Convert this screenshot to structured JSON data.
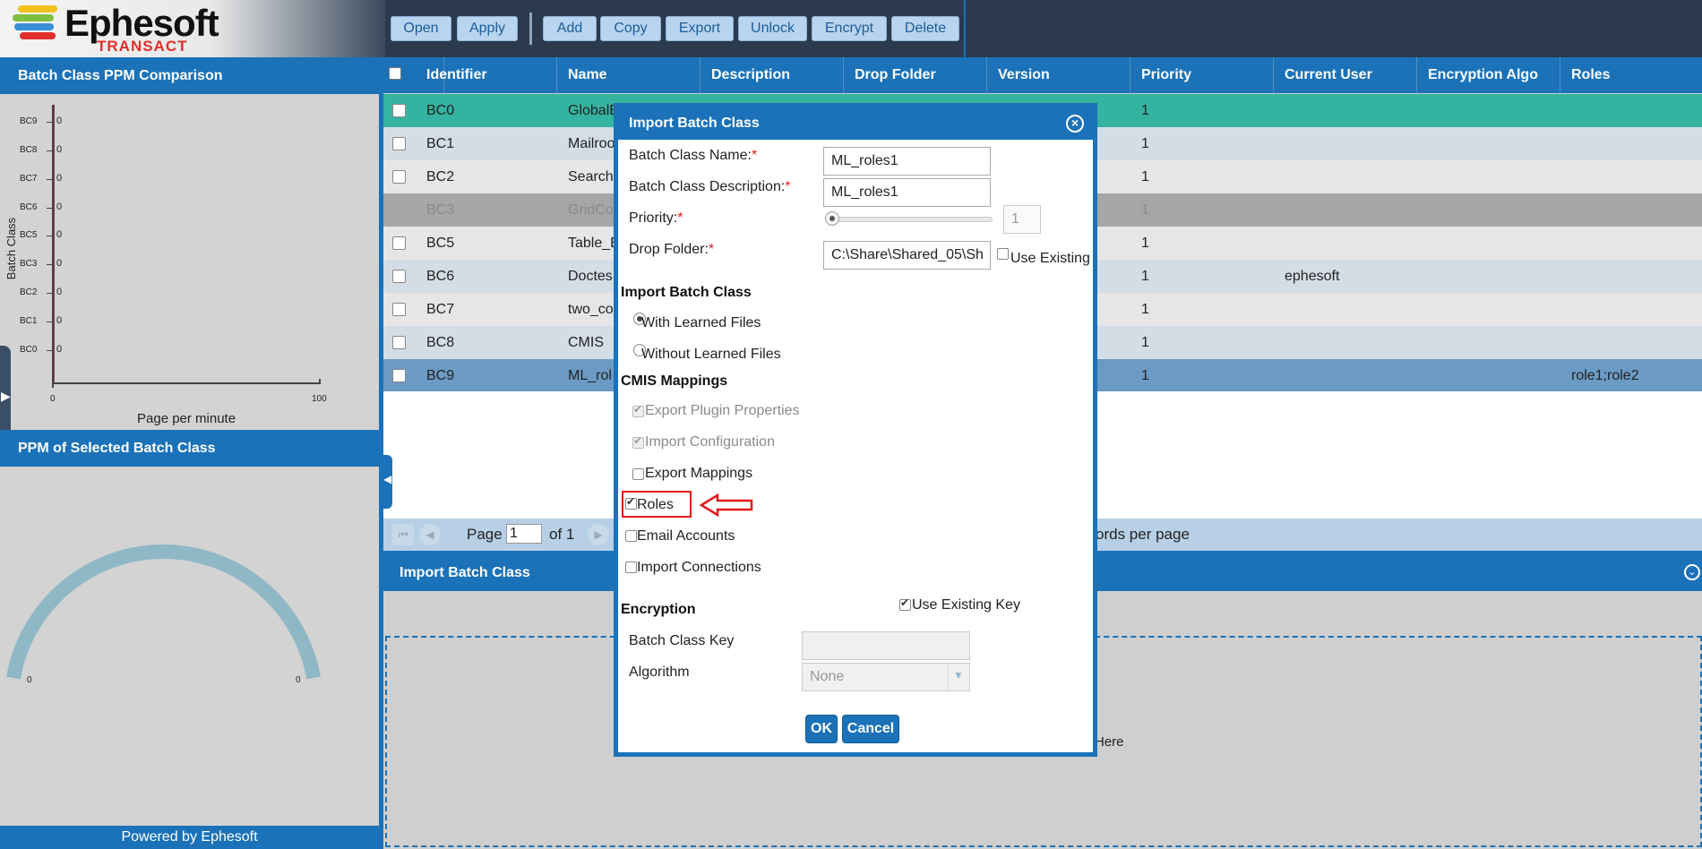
{
  "app": {
    "logo_text": "Ephesoft",
    "logo_sub": "TRANSACT",
    "footer": "Powered by Ephesoft"
  },
  "toolbar": {
    "buttons": [
      "Open",
      "Apply",
      "Add",
      "Copy",
      "Export",
      "Unlock",
      "Encrypt",
      "Delete"
    ]
  },
  "left": {
    "ppm_title": "Batch Class PPM Comparison",
    "selected_title": "PPM of Selected Batch Class",
    "gauge_min": "0",
    "gauge_max": "0"
  },
  "chart_data": {
    "type": "bar",
    "orientation": "horizontal",
    "categories": [
      "BC9",
      "BC8",
      "BC7",
      "BC6",
      "BC5",
      "BC3",
      "BC2",
      "BC1",
      "BC0"
    ],
    "values": [
      0,
      0,
      0,
      0,
      0,
      0,
      0,
      0,
      0
    ],
    "value_labels": [
      "0",
      "0",
      "0",
      "0",
      "0",
      "0",
      "0",
      "0",
      "0"
    ],
    "xlabel": "Page per minute",
    "ylabel": "Batch Class",
    "xlim": [
      0,
      100
    ],
    "x_ticks": [
      "0",
      "100"
    ]
  },
  "grid": {
    "columns": [
      "Identifier",
      "Name",
      "Description",
      "Drop Folder",
      "Version",
      "Priority",
      "Current User",
      "Encryption Algo",
      "Roles"
    ],
    "rows": [
      {
        "id": "BC0",
        "name": "GlobalE",
        "priority": "1",
        "user": "",
        "roles": ""
      },
      {
        "id": "BC1",
        "name": "Mailroo",
        "priority": "1",
        "user": "",
        "roles": ""
      },
      {
        "id": "BC2",
        "name": "Search",
        "priority": "1",
        "user": "",
        "roles": ""
      },
      {
        "id": "BC3",
        "name": "GridCo",
        "priority": "1",
        "user": "",
        "roles": ""
      },
      {
        "id": "BC5",
        "name": "Table_E",
        "priority": "1",
        "user": "",
        "roles": ""
      },
      {
        "id": "BC6",
        "name": "Doctes",
        "priority": "1",
        "user": "ephesoft",
        "roles": ""
      },
      {
        "id": "BC7",
        "name": "two_co",
        "priority": "1",
        "user": "",
        "roles": ""
      },
      {
        "id": "BC8",
        "name": "CMIS",
        "priority": "1",
        "user": "",
        "roles": ""
      },
      {
        "id": "BC9",
        "name": "ML_rol",
        "priority": "1",
        "user": "",
        "roles": "role1;role2"
      }
    ],
    "pager_page_label": "Page",
    "pager_page_value": "1",
    "pager_of": "of 1",
    "pager_records": "ords per page"
  },
  "import_panel": {
    "title": "Import Batch Class",
    "drop_hint": "Here"
  },
  "dialog": {
    "title": "Import Batch Class",
    "name_label": "Batch Class Name:",
    "name_value": "ML_roles1",
    "desc_label": "Batch Class Description:",
    "desc_value": "ML_roles1",
    "priority_label": "Priority:",
    "priority_value": "1",
    "drop_label": "Drop Folder:",
    "drop_value": "C:\\Share\\Shared_05\\Sh",
    "use_existing": "Use Existing",
    "import_section": "Import Batch Class",
    "with_learned": "With Learned Files",
    "without_learned": "Without Learned Files",
    "cmis_section": "CMIS Mappings",
    "export_plugin": "Export Plugin Properties",
    "import_config": "Import Configuration",
    "export_mappings": "Export Mappings",
    "roles": "Roles",
    "email_accounts": "Email Accounts",
    "import_connections": "Import Connections",
    "encryption_section": "Encryption",
    "use_existing_key": "Use Existing Key",
    "key_label": "Batch Class Key",
    "algo_label": "Algorithm",
    "algo_value": "None",
    "ok": "OK",
    "cancel": "Cancel"
  },
  "colors": {
    "brand_blue": "#1b72b8",
    "selected_row": "#34b3a0",
    "highlight_row": "#6b9ac4",
    "annotation_red": "#e01b1b"
  }
}
